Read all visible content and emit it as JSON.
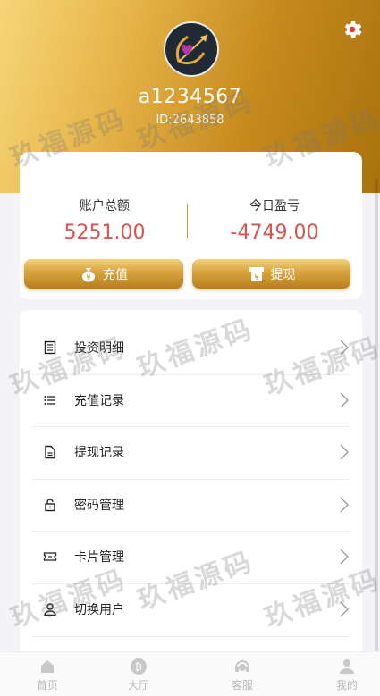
{
  "profile": {
    "username": "a1234567",
    "user_id": "ID:2643858",
    "avatar_icon": "cupid-bow-heart-icon"
  },
  "balance": {
    "total_label": "账户总额",
    "total_value": "5251.00",
    "today_label": "今日盈亏",
    "today_value": "-4749.00",
    "recharge_label": "充值",
    "withdraw_label": "提现"
  },
  "menu": {
    "items": [
      {
        "label": "投资明细",
        "icon": "document-list-icon"
      },
      {
        "label": "充值记录",
        "icon": "list-icon"
      },
      {
        "label": "提现记录",
        "icon": "file-icon"
      },
      {
        "label": "密码管理",
        "icon": "lock-icon"
      },
      {
        "label": "卡片管理",
        "icon": "card-icon"
      },
      {
        "label": "切换用户",
        "icon": "user-icon"
      }
    ]
  },
  "tabbar": {
    "items": [
      {
        "label": "首页",
        "icon": "home-icon"
      },
      {
        "label": "大厅",
        "icon": "bitcoin-icon"
      },
      {
        "label": "客服",
        "icon": "headset-icon"
      },
      {
        "label": "我的",
        "icon": "user-icon"
      }
    ]
  },
  "watermark_text": "玖福源码",
  "colors": {
    "accent_gold": "#c58a1e",
    "value_red": "#d9534f",
    "settings_red": "#e53935"
  }
}
